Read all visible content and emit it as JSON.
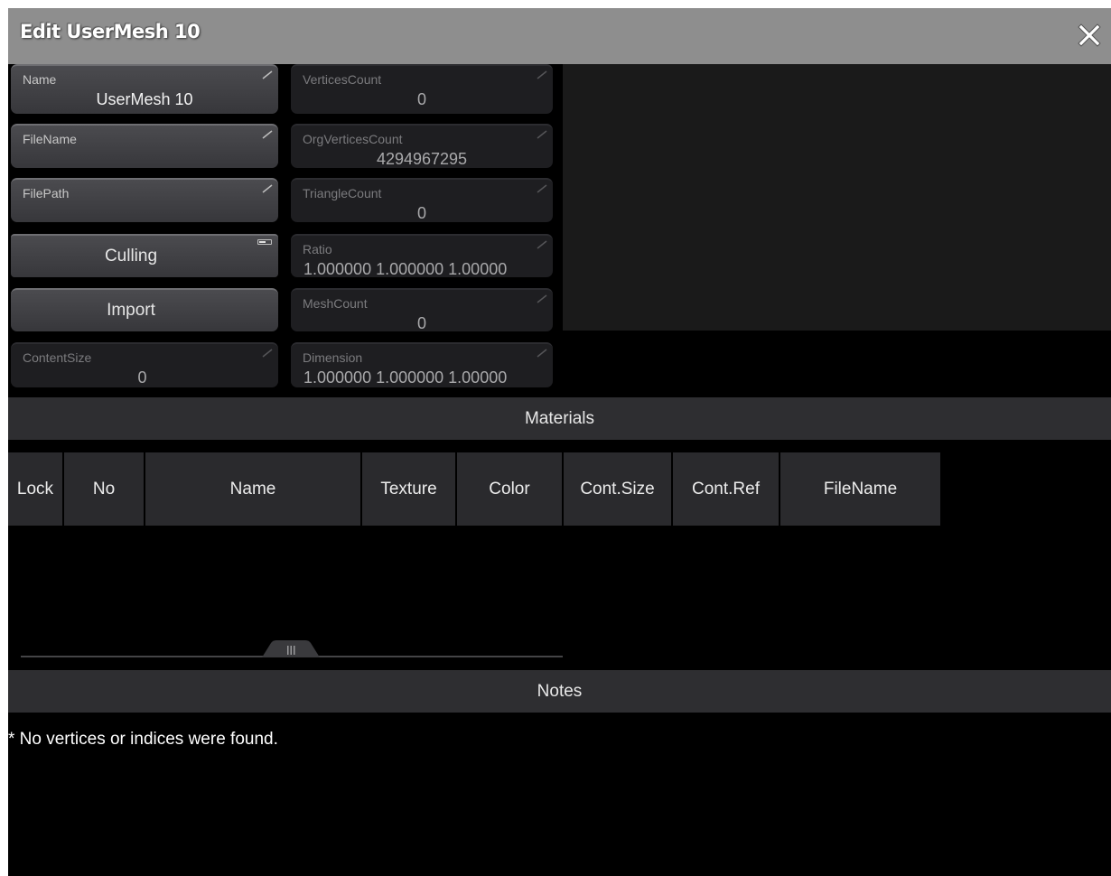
{
  "dialog": {
    "title": "Edit UserMesh 10",
    "close_icon": "close-x-icon"
  },
  "properties_left": {
    "name": {
      "label": "Name",
      "value": "UserMesh 10"
    },
    "filename": {
      "label": "FileName",
      "value": ""
    },
    "filepath": {
      "label": "FilePath",
      "value": ""
    },
    "culling": {
      "label": "Culling"
    },
    "import": {
      "label": "Import"
    },
    "content_size": {
      "label": "ContentSize",
      "value": "0"
    }
  },
  "properties_right": {
    "vertices_count": {
      "label": "VerticesCount",
      "value": "0"
    },
    "org_vertices_count": {
      "label": "OrgVerticesCount",
      "value": "4294967295"
    },
    "triangle_count": {
      "label": "TriangleCount",
      "value": "0"
    },
    "ratio": {
      "label": "Ratio",
      "value": "1.000000 1.000000 1.00000"
    },
    "mesh_count": {
      "label": "MeshCount",
      "value": "0"
    },
    "dimension": {
      "label": "Dimension",
      "value": "1.000000 1.000000 1.00000"
    }
  },
  "materials": {
    "title": "Materials",
    "columns": [
      "Lock",
      "No",
      "Name",
      "Texture",
      "Color",
      "Cont.Size",
      "Cont.Ref",
      "FileName"
    ],
    "rows": []
  },
  "notes": {
    "title": "Notes",
    "text": "* No vertices or indices were found."
  },
  "colors": {
    "titlebar": "#8e8e8e",
    "background": "#000000",
    "section_header": "#2e2e31",
    "editable_cell": "#444448",
    "readonly_cell": "#1e1e21"
  }
}
